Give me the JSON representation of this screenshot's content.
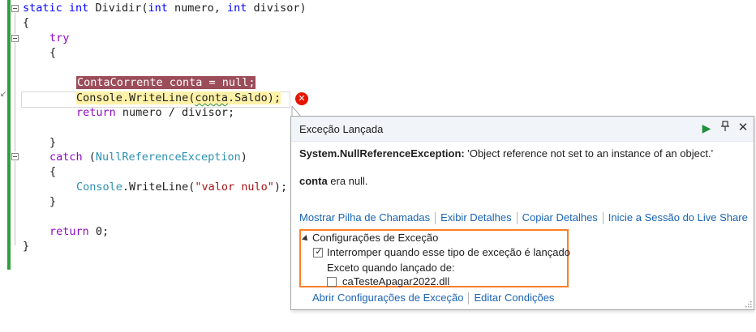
{
  "code": {
    "lines": {
      "l1": {
        "kw1": "static",
        "kw2": "int",
        "name": "Dividir(",
        "kw3": "int",
        "p1": " numero, ",
        "kw4": "int",
        "p2": " divisor)"
      },
      "l2": "{",
      "l3": "try",
      "l4": "{",
      "l6": "ContaCorrente conta = null;",
      "l7": {
        "pre": "Console",
        "dot": ".",
        "method": "WriteLine(",
        "arg": "conta",
        "rest": ".Saldo);"
      },
      "l8": {
        "kw": "return",
        "rest": " numero / divisor;"
      },
      "l10": "}",
      "l11": {
        "kw": "catch",
        "open": " (",
        "type": "NullReferenceException",
        ")": ")"
      },
      "l12": "{",
      "l13": {
        "type": "Console",
        "rest": ".WriteLine(",
        "str": "\"valor nulo\"",
        "end": ");"
      },
      "l14": "}",
      "l16": {
        "kw": "return",
        "rest": " 0;"
      },
      "l17": "}"
    }
  },
  "popup": {
    "title": "Exceção Lançada",
    "exception_type": "System.NullReferenceException:",
    "exception_message": " 'Object reference not set to an instance of an object.'",
    "null_var": "conta",
    "null_text": " era null.",
    "links": [
      "Mostrar Pilha de Chamadas",
      "Exibir Detalhes",
      "Copiar Detalhes",
      "Inicie a Sessão do Live Share"
    ],
    "settings": {
      "title": "Configurações de Exceção",
      "break_label": "Interromper quando esse tipo de exceção é lançado",
      "break_checked": true,
      "except_label": "Exceto quando lançado de:",
      "dll_label": "caTesteApagar2022.dll",
      "dll_checked": false
    },
    "bottom_links": [
      "Abrir Configurações de Exceção",
      "Editar Condições"
    ]
  },
  "colors": {
    "accent_orange": "#ff7f27",
    "link": "#1a64b4",
    "error": "#e51400",
    "gutter": "#2f9e3a"
  }
}
